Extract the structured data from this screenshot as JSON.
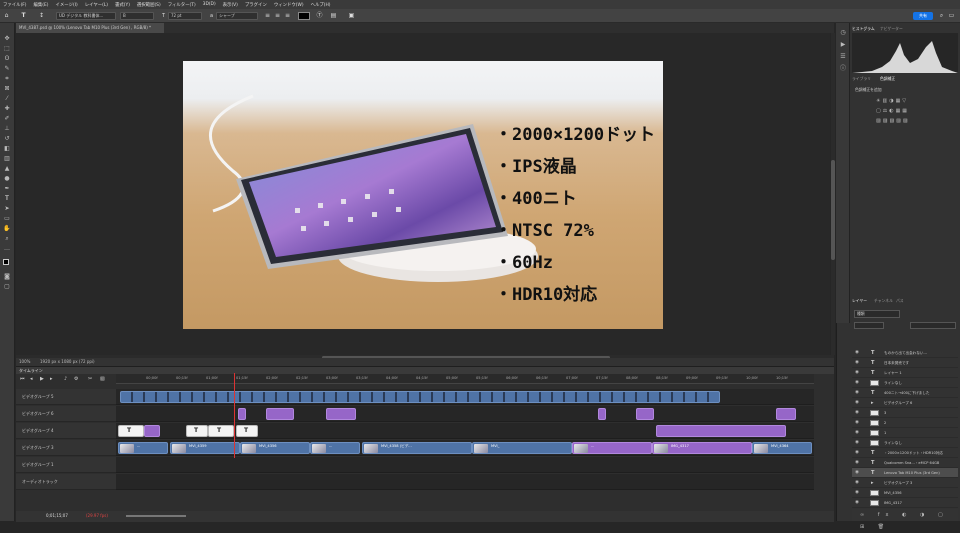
{
  "menu": [
    "ファイル(F)",
    "編集(E)",
    "イメージ(I)",
    "レイヤー(L)",
    "書式(Y)",
    "選択範囲(S)",
    "フィルター(T)",
    "3D(D)",
    "表示(V)",
    "プラグイン",
    "ウィンドウ(W)",
    "ヘルプ(H)"
  ],
  "options": {
    "font_family": "UD デジタル 教科書体...",
    "font_style": "B",
    "font_size": "72 pt",
    "aa": "シャープ",
    "share": "共有"
  },
  "doc_tab": "MVI_4387.psd @ 100% (Lenovo Tab M10 Plus (3rd Gen) , RGB/8) *",
  "canvas_text": [
    "・2000×1200ドット",
    "・IPS液晶",
    "・400ニト",
    "・NTSC 72%",
    "・60Hz",
    "・HDR10対応"
  ],
  "status": {
    "zoom": "100%",
    "size": "1920 px x 1080 px (72 ppi)"
  },
  "timeline": {
    "title": "タイムライン",
    "timecode": "0;01;15;07",
    "fps": "(29.97 fps)",
    "ticks": [
      "00;00f",
      "00;15f",
      "01;00f",
      "01;15f",
      "02;00f",
      "02;15f",
      "03;00f",
      "03;15f",
      "04;00f",
      "04;15f",
      "05;00f",
      "05;15f",
      "06;00f",
      "06;15f",
      "07;00f",
      "07;15f",
      "08;00f",
      "08;15f",
      "09;00f",
      "09;15f",
      "10;00f",
      "10;15f"
    ],
    "tracks": [
      {
        "label": "ビデオグループ 5"
      },
      {
        "label": "ビデオグループ 6"
      },
      {
        "label": "ビデオグループ 4"
      },
      {
        "label": "ビデオグループ 3"
      },
      {
        "label": "ビデオグループ 1"
      },
      {
        "label": "オーディオトラック"
      }
    ],
    "clip_labels": [
      "MVI_4359",
      "MVI_4356",
      "MVI_4358 (ビデ...",
      "MVI_",
      "IMG_4317",
      "MVI_4364",
      "...",
      "T",
      "T",
      "T",
      "T"
    ]
  },
  "panel": {
    "tabs_top": [
      "ヒストグラム",
      "ナビゲーター"
    ],
    "tabs_mid": [
      "ライブラリ",
      "色調補正"
    ],
    "adj_title": "色調補正を追加",
    "tabs_layers": [
      "レイヤー",
      "チャンネル",
      "パス"
    ],
    "layer_filter": "種類",
    "layers": [
      {
        "name": "ものから出て出会わない…",
        "kind": "T"
      },
      {
        "name": "日本未発売です",
        "kind": "T"
      },
      {
        "name": "レイヤー 1",
        "kind": "T"
      },
      {
        "name": "ラインなし",
        "kind": "img"
      },
      {
        "name": "400ニト→400に下げました",
        "kind": "T"
      },
      {
        "name": "ビデオグループ 6",
        "kind": "group"
      },
      {
        "name": "3",
        "kind": "img"
      },
      {
        "name": "2",
        "kind": "img"
      },
      {
        "name": "1",
        "kind": "img"
      },
      {
        "name": "ラインなし",
        "kind": "img"
      },
      {
        "name": "・2000×1200ドット・HDR10対応",
        "kind": "T"
      },
      {
        "name": "Qualcomm Sna...・eMCP 64GB",
        "kind": "T"
      },
      {
        "name": "Lenovo Tab M10 Plus (3rd Gen)",
        "kind": "T"
      },
      {
        "name": "ビデオグループ 3",
        "kind": "group"
      },
      {
        "name": "MVI_4356",
        "kind": "img"
      },
      {
        "name": "IMG_4317",
        "kind": "img"
      }
    ]
  }
}
